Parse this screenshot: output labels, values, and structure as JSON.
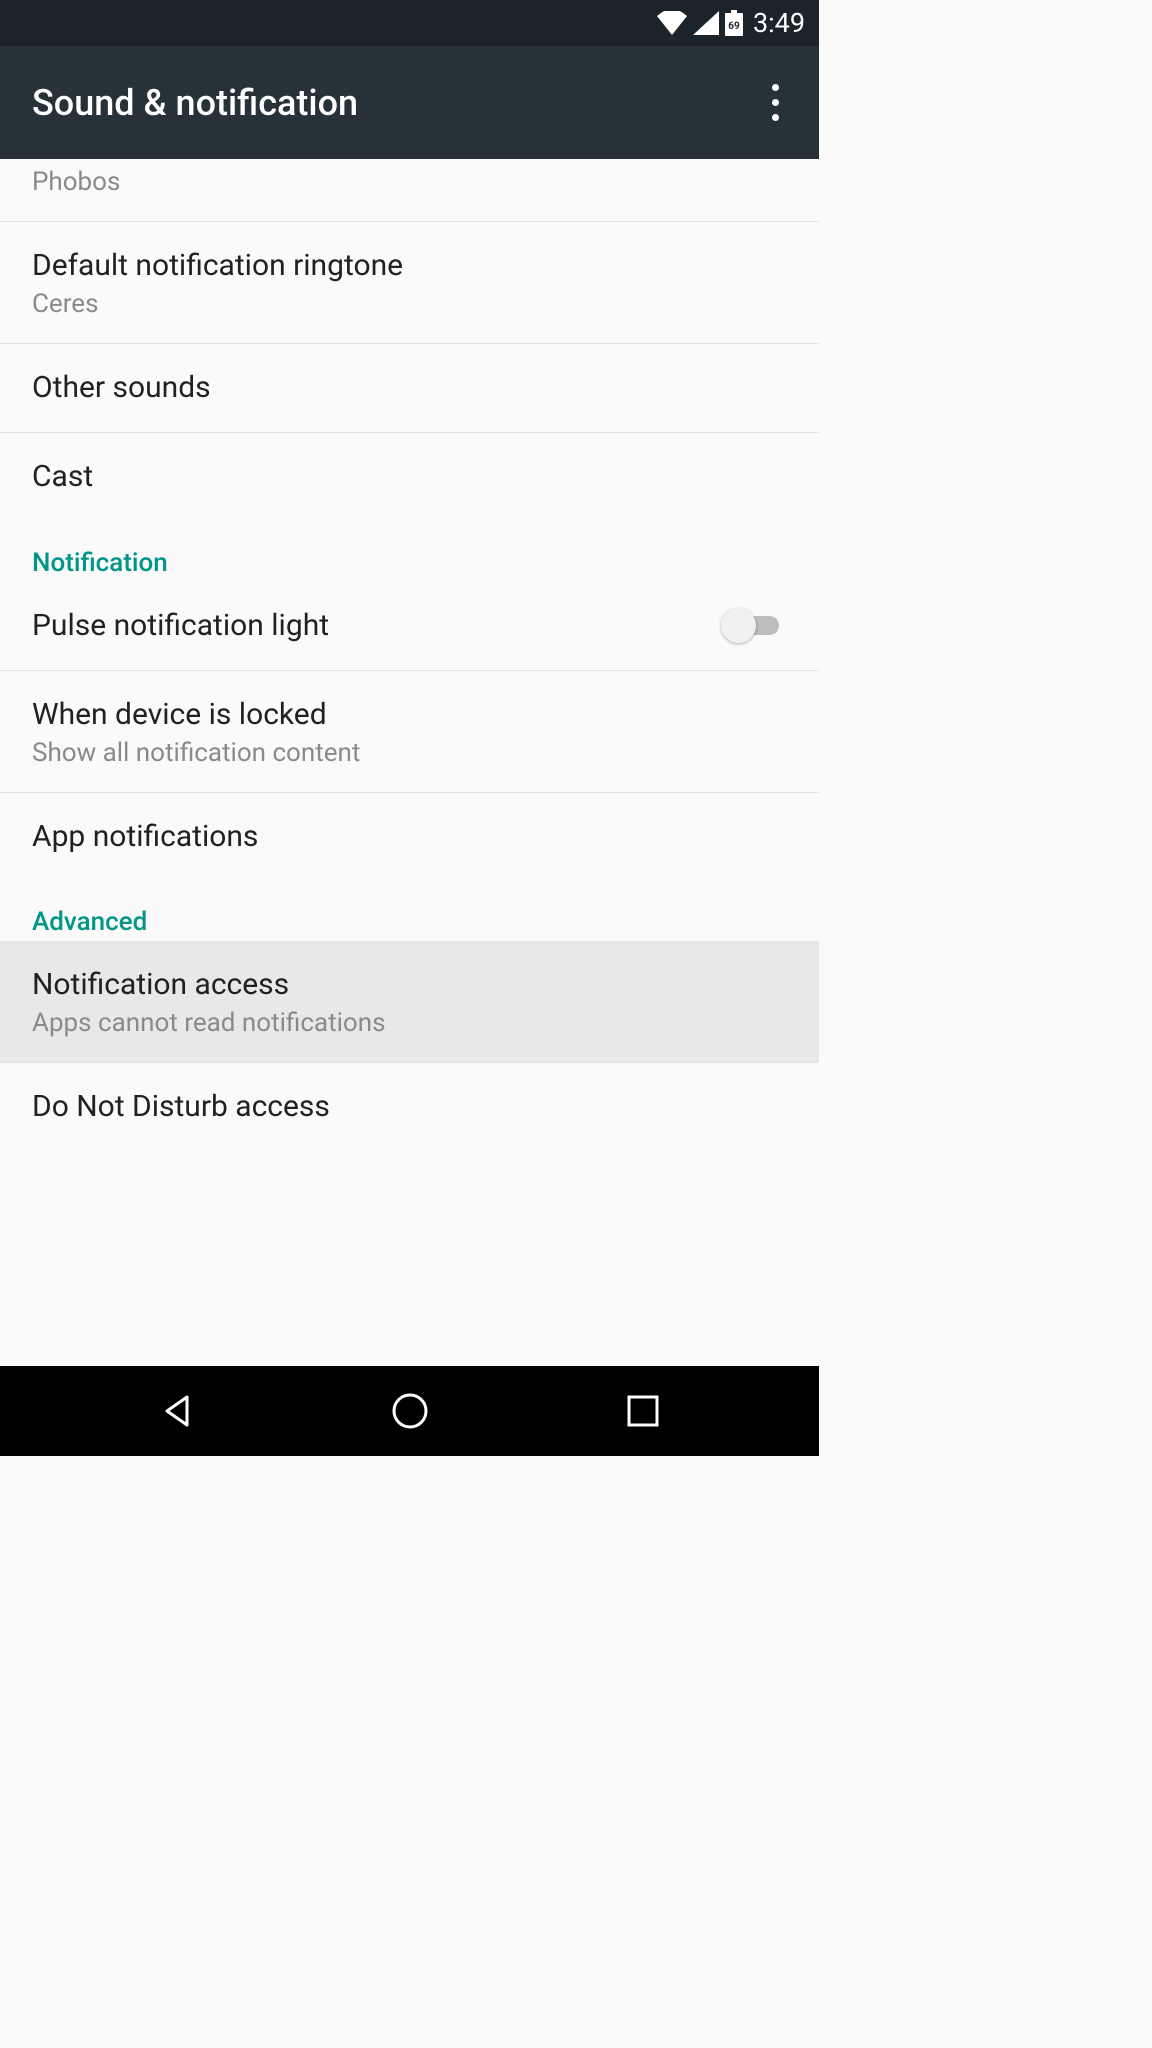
{
  "status": {
    "time": "3:49",
    "battery_level": "69"
  },
  "appbar": {
    "title": "Sound & notification"
  },
  "items": {
    "phobos_subtitle": "Phobos",
    "default_notification_ringtone": {
      "title": "Default notification ringtone",
      "subtitle": "Ceres"
    },
    "other_sounds": {
      "title": "Other sounds"
    },
    "cast": {
      "title": "Cast"
    },
    "pulse_notification_light": {
      "title": "Pulse notification light"
    },
    "when_device_locked": {
      "title": "When device is locked",
      "subtitle": "Show all notification content"
    },
    "app_notifications": {
      "title": "App notifications"
    },
    "notification_access": {
      "title": "Notification access",
      "subtitle": "Apps cannot read notifications"
    },
    "dnd_access": {
      "title": "Do Not Disturb access"
    }
  },
  "sections": {
    "notification": "Notification",
    "advanced": "Advanced"
  }
}
